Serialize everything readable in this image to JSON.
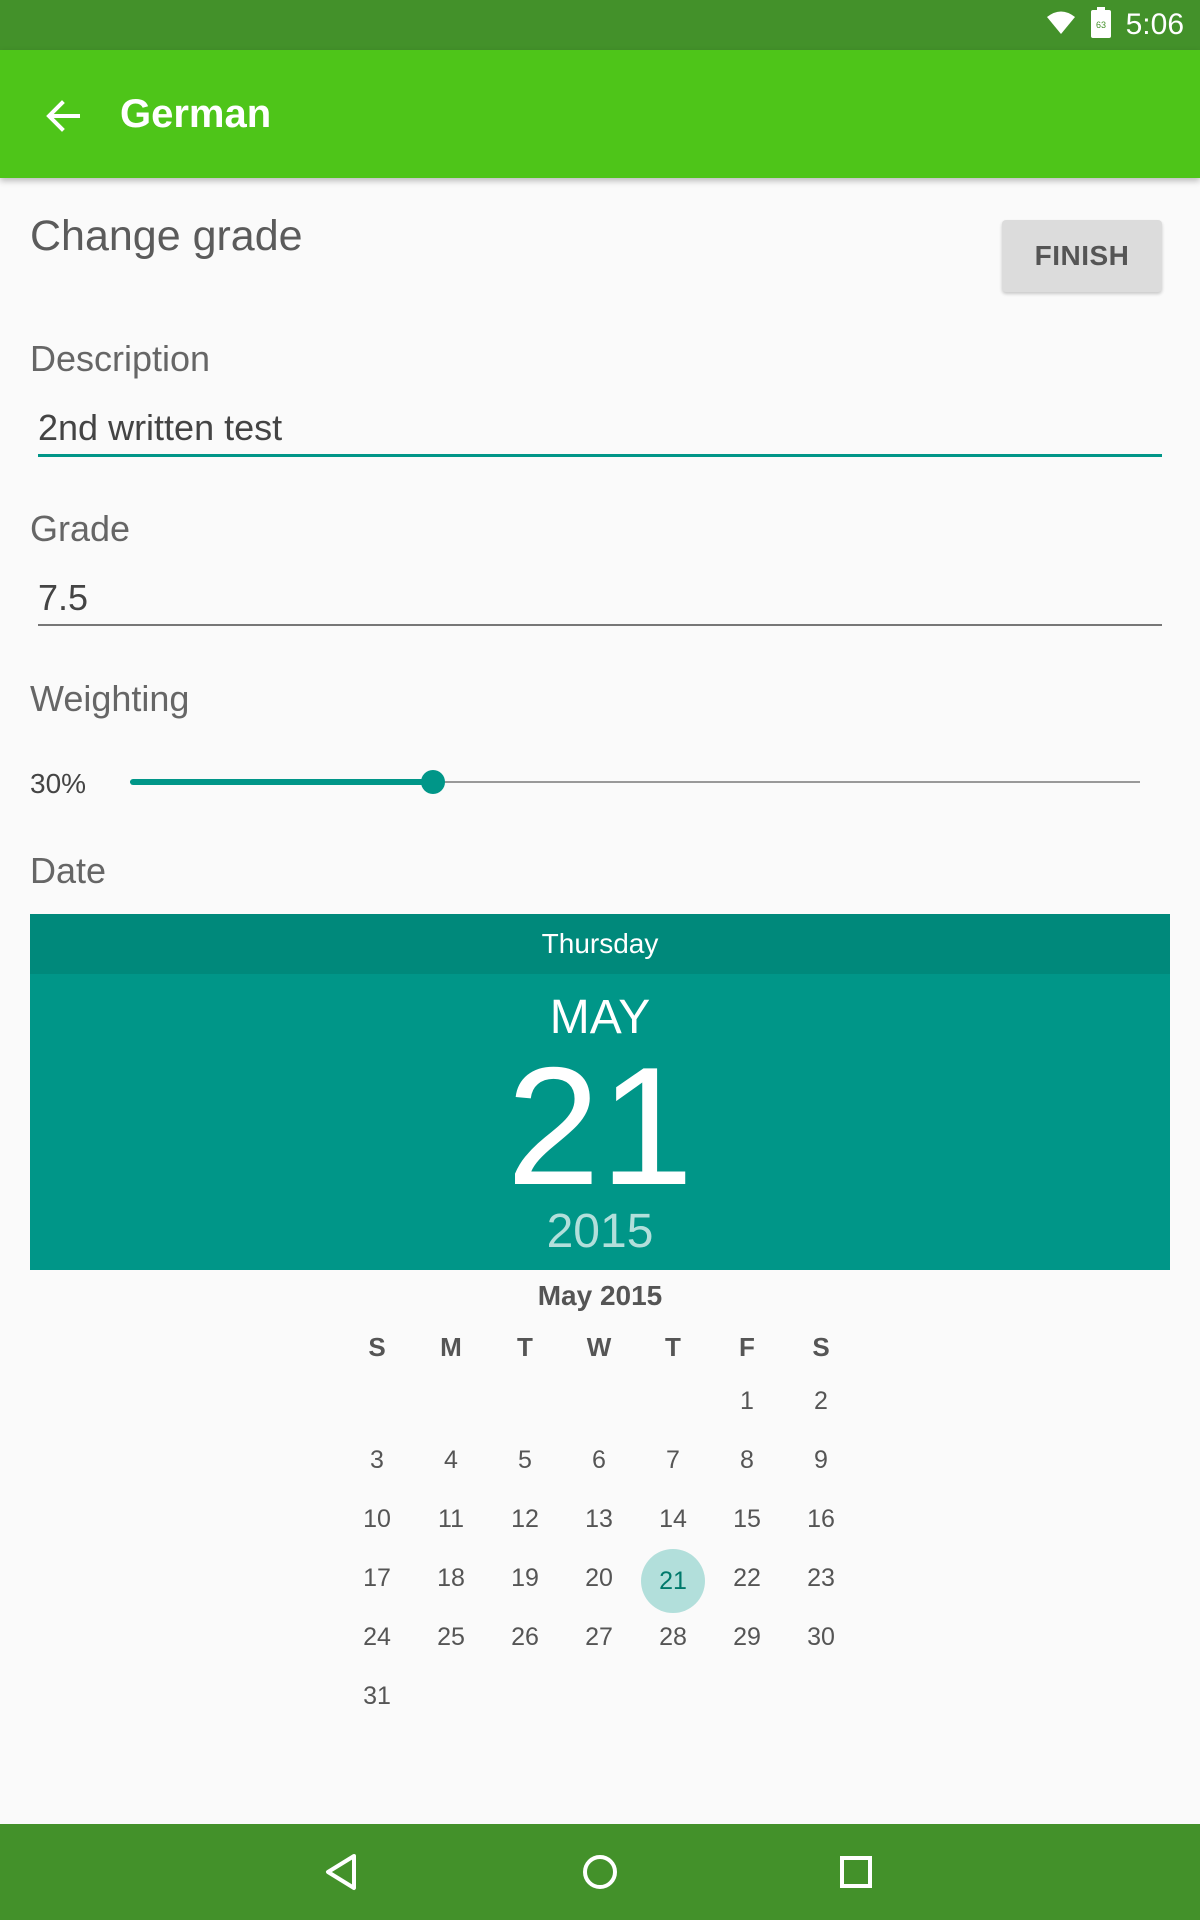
{
  "status_bar": {
    "time": "5:06",
    "wifi_icon": "wifi-icon",
    "battery_icon": "battery-icon",
    "battery_level": "63"
  },
  "app_bar": {
    "title": "German",
    "back_icon": "arrow-back-icon"
  },
  "form": {
    "title": "Change grade",
    "finish_label": "FINISH",
    "description": {
      "label": "Description",
      "value": "2nd written test"
    },
    "grade": {
      "label": "Grade",
      "value": "7.5"
    },
    "weighting": {
      "label": "Weighting",
      "value_text": "30%",
      "value": 0.3
    },
    "date_label": "Date"
  },
  "date_picker": {
    "day_name": "Thursday",
    "month": "MAY",
    "day": "21",
    "year": "2015",
    "calendar_title": "May 2015",
    "weekdays": [
      "S",
      "M",
      "T",
      "W",
      "T",
      "F",
      "S"
    ],
    "weeks": [
      [
        "",
        "",
        "",
        "",
        "",
        "1",
        "2"
      ],
      [
        "3",
        "4",
        "5",
        "6",
        "7",
        "8",
        "9"
      ],
      [
        "10",
        "11",
        "12",
        "13",
        "14",
        "15",
        "16"
      ],
      [
        "17",
        "18",
        "19",
        "20",
        "21",
        "22",
        "23"
      ],
      [
        "24",
        "25",
        "26",
        "27",
        "28",
        "29",
        "30"
      ],
      [
        "31",
        "",
        "",
        "",
        "",
        "",
        ""
      ]
    ],
    "selected_day": "21"
  },
  "nav_bar": {
    "back_icon": "nav-back-icon",
    "home_icon": "nav-home-icon",
    "recents_icon": "nav-recents-icon"
  },
  "colors": {
    "status_bar": "#43912a",
    "app_bar": "#4ec519",
    "accent": "#009688",
    "accent_dark": "#00897b",
    "selected_day_bg": "#b2dfdb"
  }
}
